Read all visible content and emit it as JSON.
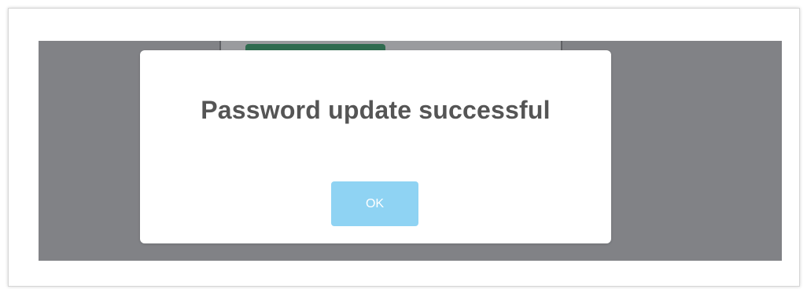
{
  "dialog": {
    "title": "Password update successful",
    "ok_label": "OK"
  },
  "colors": {
    "overlay": "#818286",
    "button": "#8fd3f3",
    "title_text": "#555555"
  }
}
